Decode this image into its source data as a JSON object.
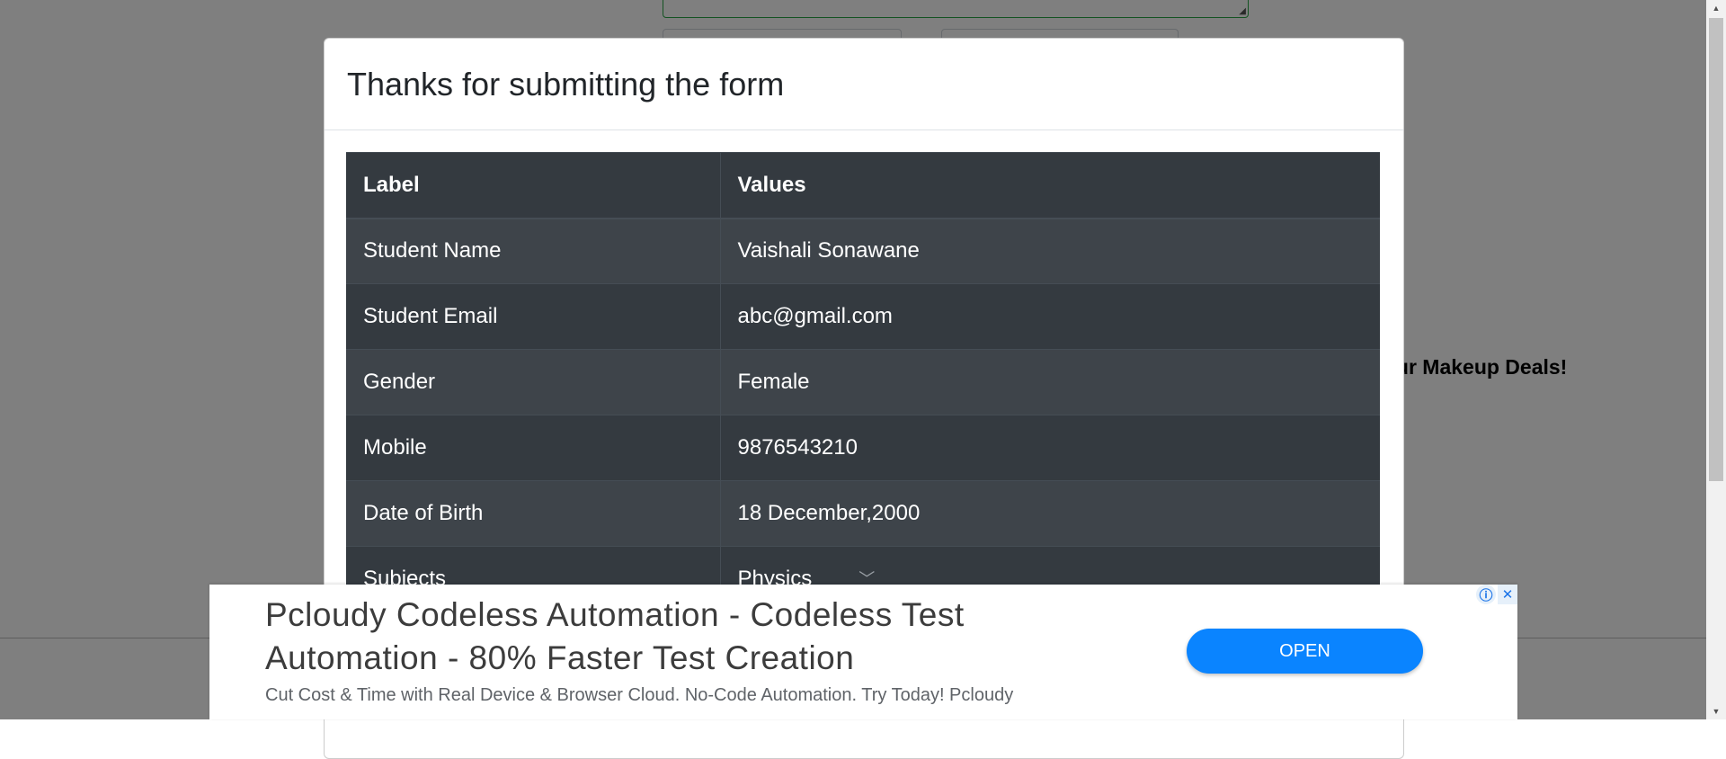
{
  "background": {
    "ad_partial_text": "Our Makeup Deals!"
  },
  "modal": {
    "title": "Thanks for submitting the form",
    "table": {
      "headers": [
        "Label",
        "Values"
      ],
      "rows": [
        {
          "label": "Student Name",
          "value": "Vaishali Sonawane"
        },
        {
          "label": "Student Email",
          "value": "abc@gmail.com"
        },
        {
          "label": "Gender",
          "value": "Female"
        },
        {
          "label": "Mobile",
          "value": "9876543210"
        },
        {
          "label": "Date of Birth",
          "value": "18 December,2000"
        },
        {
          "label": "Subjects",
          "value": "Physics"
        }
      ]
    }
  },
  "ad": {
    "headline": "Pcloudy Codeless Automation - Codeless Test Automation - 80% Faster Test Creation",
    "description": "Cut Cost & Time with Real Device & Browser Cloud. No-Code Automation. Try Today! Pcloudy",
    "button_label": "OPEN",
    "info_icon": "ⓘ",
    "close_icon": "✕"
  },
  "colors": {
    "overlay": "#808080",
    "table_dark": "#343a40",
    "table_stripe": "#3e444a",
    "ad_button": "#0a84ff"
  }
}
